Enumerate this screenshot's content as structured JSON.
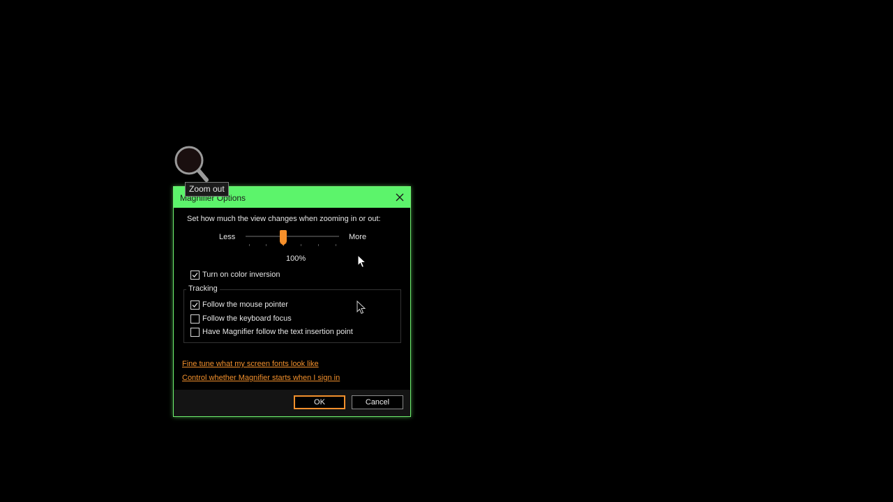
{
  "tooltip": {
    "text": "Zoom out"
  },
  "dialog": {
    "title": "Magnifier Options",
    "instruction": "Set how much the view changes when zooming in or out:",
    "slider": {
      "less_label": "Less",
      "more_label": "More",
      "value_label": "100%",
      "position_fraction": 0.4
    },
    "color_inversion": {
      "label": "Turn on color inversion",
      "checked": true
    },
    "tracking": {
      "group_label": "Tracking",
      "options": [
        {
          "label": "Follow the mouse pointer",
          "checked": true
        },
        {
          "label": "Follow the keyboard focus",
          "checked": false
        },
        {
          "label": "Have Magnifier follow the text insertion point",
          "checked": false
        }
      ]
    },
    "links": {
      "fonts": "Fine tune what my screen fonts look like",
      "signin": "Control whether Magnifier starts when I sign in"
    },
    "buttons": {
      "ok": "OK",
      "cancel": "Cancel"
    }
  },
  "colors": {
    "title_bar": "#5cf46b",
    "accent": "#f2902c",
    "background": "#000000"
  }
}
